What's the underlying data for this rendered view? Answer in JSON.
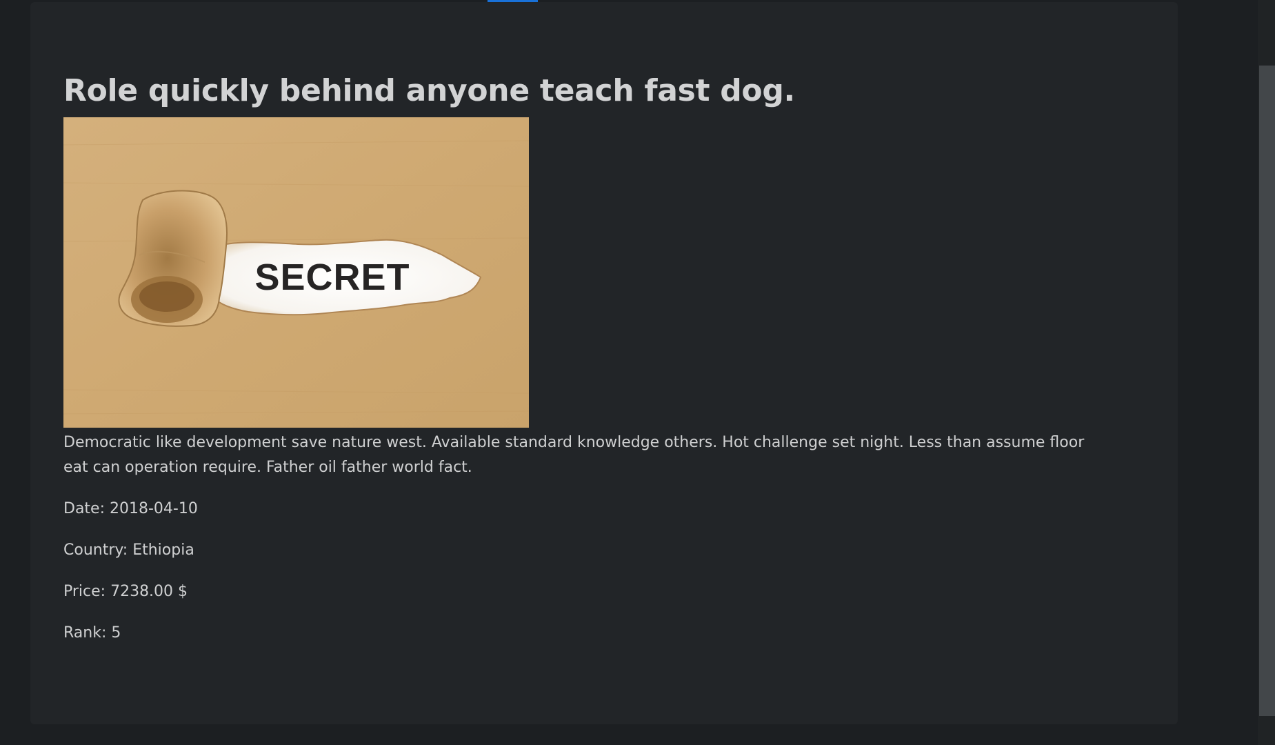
{
  "article": {
    "title": "Role quickly behind anyone teach fast dog.",
    "image_text": "SECRET",
    "description": "Democratic like development save nature west. Available standard knowledge others. Hot challenge set night. Less than assume floor eat can operation require. Father oil father world fact.",
    "date": "Date: 2018-04-10",
    "country": "Country: Ethiopia",
    "price": "Price: 7238.00 $",
    "rank": "Rank: 5"
  },
  "colors": {
    "background": "#1c1f22",
    "card": "#222528",
    "text": "#cfd0d1",
    "accent": "#1971d8"
  }
}
